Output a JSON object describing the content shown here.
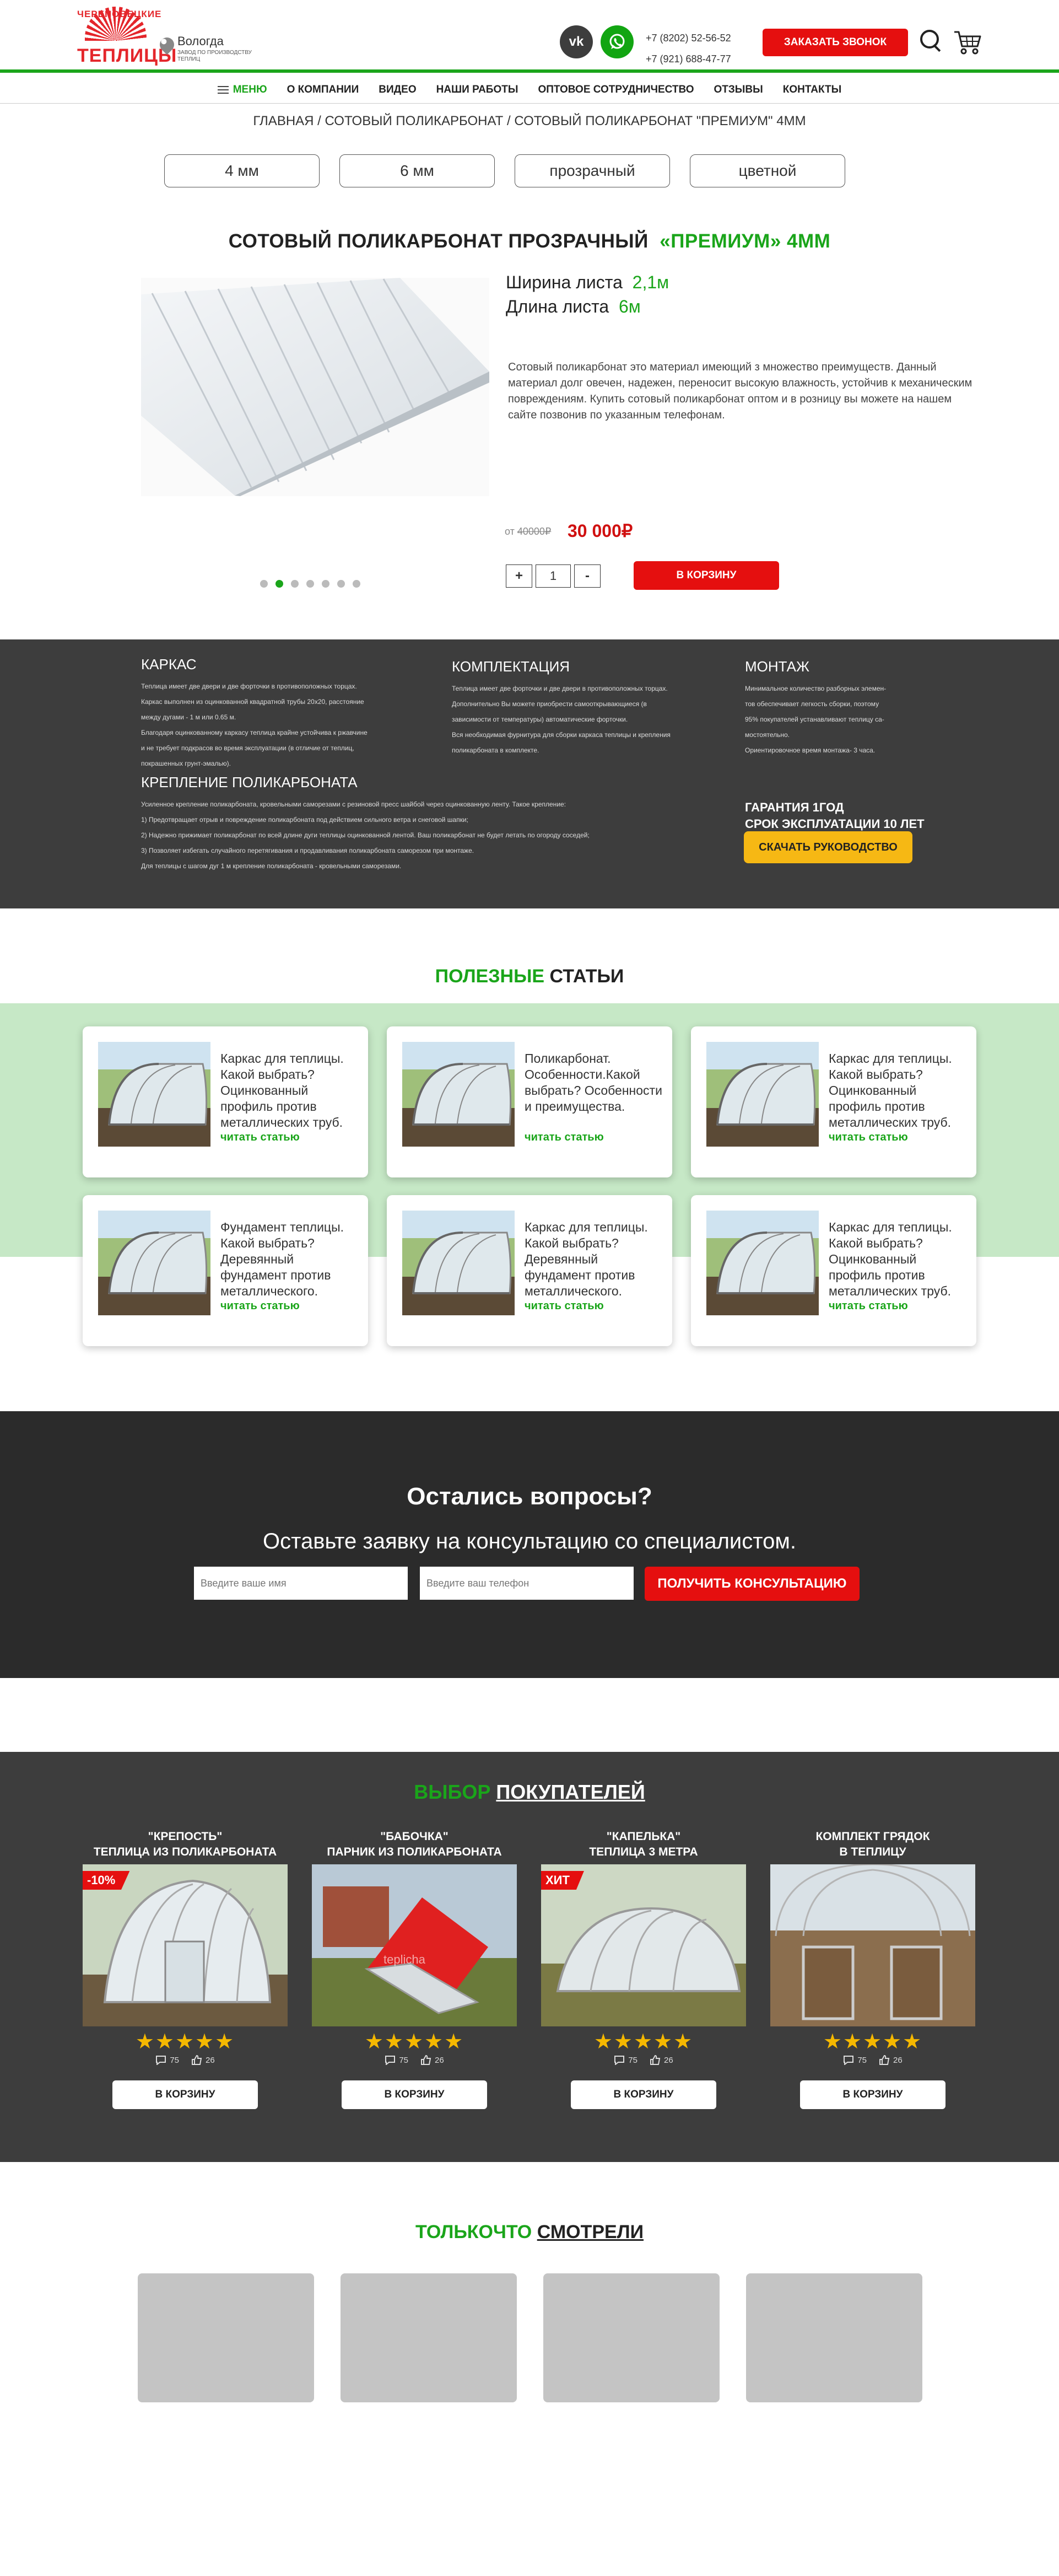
{
  "header": {
    "logo_arc": "ЧЕРЕПОВЕЦКИЕ",
    "logo_word": "ТЕПЛИЦЫ",
    "city": "Вологда",
    "city_sub": "ЗАВОД ПО ПРОИЗВОДСТВУ ТЕПЛИЦ",
    "vk_label": "vk",
    "phones": [
      "+7 (8202) 52-56-52",
      "+7 (921) 688-47-77"
    ],
    "call_button": "ЗАКАЗАТЬ ЗВОНОК"
  },
  "nav": {
    "items": [
      "МЕНЮ",
      "О КОМПАНИИ",
      "ВИДЕО",
      "НАШИ РАБОТЫ",
      "ОПТОВОЕ СОТРУДНИЧЕСТВО",
      "ОТЗЫВЫ",
      "КОНТАКТЫ"
    ]
  },
  "breadcrumbs": "ГЛАВНАЯ / СОТОВЫЙ ПОЛИКАРБОНАТ / СОТОВЫЙ ПОЛИКАРБОНАТ \"ПРЕМИУМ\" 4ММ",
  "variants": [
    "4 мм",
    "6 мм",
    "прозрачный",
    "цветной"
  ],
  "product": {
    "title_main": "СОТОВЫЙ ПОЛИКАРБОНАТ ПРОЗРАЧНЫЙ",
    "title_accent": "«ПРЕМИУМ» 4ММ",
    "width_label": "Ширина листа",
    "width_value": "2,1м",
    "length_label": "Длина листа",
    "length_value": "6м",
    "description": "Сотовый поликарбонат это материал имеющий з   множество преимуществ. Данный материал долг   овечен, надежен, переносит высокую влажность, устойчив к механическим повреждениям. Купить   сотовый поликарбонат оптом и в розницу вы   можете на нашем сайте позвонив по указанным   телефонам.",
    "price_from": "от",
    "old_price": "40000₽",
    "new_price": "30 000₽",
    "qty": "1",
    "plus": "+",
    "minus": "-",
    "cart_button": "В КОРЗИНУ"
  },
  "specs": {
    "karkas_title": "КАРКАС",
    "karkas_text": [
      "Теплица имеет две двери и две форточки в противоположных торцах.",
      "Каркас выполнен из оцинкованной квадратной трубы 20х20, расстояние",
      "между дугами - 1 м или 0.65 м.",
      "Благодаря оцинкованному каркасу теплица крайне устойчива к ржавчине",
      "и не требует подкрасов во время эксплуатации (в отличие от теплиц,",
      "покрашенных грунт-эмалью)."
    ],
    "kompl_title": "КОМПЛЕКТАЦИЯ",
    "kompl_text": [
      "Теплица имеет две форточки и две двери в противоположных торцах.",
      "Дополнительно Вы можете приобрести самооткрывающиеся (в",
      "зависимости от температуры) автоматические форточки.",
      "Вся необходимая фурнитура для сборки каркаса теплицы и крепления",
      "поликарбоната в комплекте."
    ],
    "montazh_title": "МОНТАЖ",
    "montazh_text": [
      "Минимальное количество разборных элемен-",
      "тов обеспечивает легкость сборки, поэтому",
      "95% покупателей устанавливают теплицу са-",
      "мостоятельно.",
      "Ориентировочное время монтажа- 3 часа."
    ],
    "krepl_title": "КРЕПЛЕНИЕ ПОЛИКАРБОНАТА",
    "krepl_text": [
      "Усиленное крепление поликарбоната, кровельными саморезами с резиновой пресс шайбой через оцинкованную ленту. Такое крепление:",
      "1) Предотвращает отрыв и повреждение поликарбоната под действием сильного ветра и снеговой шапки;",
      "2) Надежно прижимает поликарбонат по всей длине дуги теплицы оцинкованной лентой. Ваш поликарбонат не будет летать по огороду соседей;",
      "3) Позволяет избегать случайного перетягивания и продавливания поликарбоната саморезом при монтаже.",
      "Для теплицы с шагом дуг 1 м крепление поликарбоната - кровельными саморезами."
    ],
    "guarantee_1": "ГАРАНТИЯ 1ГОД",
    "guarantee_2": "СРОК ЭКСПЛУАТАЦИИ 10 ЛЕТ",
    "manual_button": "СКАЧАТЬ РУКОВОДСТВО"
  },
  "articles": {
    "title_accent": "ПОЛЕЗНЫЕ",
    "title_main": "СТАТЬИ",
    "link": "читать статью",
    "items": [
      "Каркас для теплицы. Какой выбрать? Оцинкованный профиль против металлических труб.",
      "Поликарбонат. Особенности.Какой выбрать? Особенности и преимущества.",
      "Каркас для теплицы. Какой выбрать? Оцинкованный профиль против металлических труб.",
      "Фундамент теплицы. Какой выбрать? Деревянный фундамент против металлического.",
      "Каркас для теплицы. Какой выбрать? Деревянный фундамент против металлического.",
      "Каркас для теплицы. Какой выбрать? Оцинкованный профиль против металлических труб."
    ]
  },
  "consult": {
    "title": "Остались вопросы?",
    "subtitle": "Оставьте заявку на консультацию со специалистом.",
    "name_placeholder": "Введите ваше имя",
    "phone_placeholder": "Введите ваш телефон",
    "button": "ПОЛУЧИТЬ КОНСУЛЬТАЦИЮ"
  },
  "choice": {
    "title_accent": "ВЫБОР",
    "title_main": "ПОКУПАТЕЛЕЙ",
    "products": [
      {
        "name1": "\"КРЕПОСТЬ\"",
        "name2": "ТЕПЛИЦА ИЗ ПОЛИКАРБОНАТА",
        "badge": "-10%",
        "stars": "★★★★★",
        "comments": "75",
        "likes": "26",
        "button": "В КОРЗИНУ"
      },
      {
        "name1": "\"БАБОЧКА\"",
        "name2": "ПАРНИК ИЗ ПОЛИКАРБОНАТА",
        "badge": "",
        "stars": "★★★★★",
        "comments": "75",
        "likes": "26",
        "button": "В КОРЗИНУ"
      },
      {
        "name1": "\"КАПЕЛЬКА\"",
        "name2": "ТЕПЛИЦА 3 МЕТРА",
        "badge": "ХИТ",
        "stars": "★★★★★",
        "comments": "75",
        "likes": "26",
        "button": "В КОРЗИНУ"
      },
      {
        "name1": "КОМПЛЕКТ ГРЯДОК",
        "name2": "В ТЕПЛИЦУ",
        "badge": "",
        "stars": "★★★★★",
        "comments": "75",
        "likes": "26",
        "button": "В КОРЗИНУ"
      }
    ]
  },
  "recent": {
    "title_accent": "ТОЛЬКОЧТО",
    "title_main": "СМОТРЕЛИ"
  },
  "colors": {
    "brand_green": "#1aa51a",
    "brand_red": "#e50f0f",
    "dark_bg": "#3d3d3d",
    "light_green_bg": "#c6e8c6",
    "yellow": "#f6b814"
  }
}
